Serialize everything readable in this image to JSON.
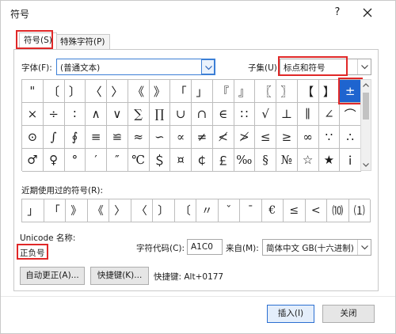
{
  "window": {
    "title": "符号",
    "help": "?",
    "close_icon": "close-icon"
  },
  "tabs": [
    {
      "label": "符号(S)",
      "active": true
    },
    {
      "label": "特殊字符(P)",
      "active": false
    }
  ],
  "font": {
    "label": "字体(F):",
    "value": "(普通文本)"
  },
  "subset": {
    "label": "子集(U):",
    "value": "标点和符号"
  },
  "symbol_grid": {
    "rows": [
      [
        "\"",
        "〔",
        "〕",
        "〈",
        "〉",
        "《",
        "》",
        "「",
        "」",
        "『",
        "』",
        "〖",
        "〗",
        "【",
        "】",
        "±"
      ],
      [
        "×",
        "÷",
        "∶",
        "∧",
        "∨",
        "∑",
        "∏",
        "∪",
        "∩",
        "∈",
        "∷",
        "√",
        "⊥",
        "∥",
        "∠",
        "⌒"
      ],
      [
        "⊙",
        "∫",
        "∮",
        "≡",
        "≌",
        "≈",
        "∽",
        "∝",
        "≠",
        "≮",
        "≯",
        "≤",
        "≥",
        "∞",
        "∵",
        "∴"
      ],
      [
        "♂",
        "♀",
        "°",
        "′",
        "″",
        "℃",
        "＄",
        "¤",
        "￠",
        "￡",
        "‰",
        "§",
        "№",
        "☆",
        "★",
        "ｉ"
      ]
    ],
    "selected": "±"
  },
  "recent": {
    "label": "近期使用过的符号(R):",
    "symbols": [
      "」",
      "「",
      "》",
      "《",
      "〉",
      "〈",
      "〕",
      "〔",
      "〃",
      "ˇ",
      "ˉ",
      "€",
      "≤",
      "<",
      "⑽",
      "⑴"
    ]
  },
  "unicode": {
    "label": "Unicode 名称:",
    "name": "正负号"
  },
  "char_code": {
    "label": "字符代码(C):",
    "value": "A1C0"
  },
  "from": {
    "label": "来自(M):",
    "value": "简体中文 GB(十六进制)"
  },
  "buttons": {
    "autocorrect": "自动更正(A)...",
    "shortcut_key": "快捷键(K)...",
    "shortcut_text": "快捷键: Alt+0177",
    "insert": "插入(I)",
    "close": "关闭"
  },
  "colors": {
    "highlight": "#e02828",
    "selection": "#1e64cf"
  }
}
